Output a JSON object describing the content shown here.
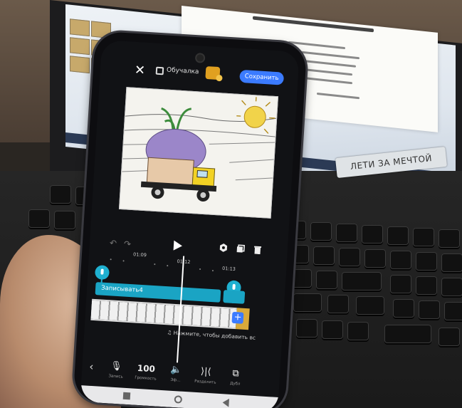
{
  "editor": {
    "project_name": "Обучалка",
    "save_label": "Сохранить",
    "audio_clip_label": "Записывать4",
    "add_music_hint": "Нажмите, чтобы добавить вс",
    "timeline_ticks": [
      "01:09",
      "01:12",
      "01:13"
    ],
    "toolbar": [
      {
        "icon": "mic-icon",
        "value": "",
        "label": "Запись"
      },
      {
        "icon": "volume-value",
        "value": "100",
        "label": "Громкость"
      },
      {
        "icon": "speaker-icon",
        "value": "",
        "label": "Эф..."
      },
      {
        "icon": "split-icon",
        "value": "",
        "label": "Разделить"
      },
      {
        "icon": "duplicate-icon",
        "value": "",
        "label": "Дубл"
      }
    ]
  },
  "background": {
    "sticker_text": "ЛЕТИ ЗА МЕЧТОЙ"
  },
  "colors": {
    "accent": "#3b7bff",
    "audio_track": "#1aa4c4",
    "pro_badge": "#e0a020"
  }
}
